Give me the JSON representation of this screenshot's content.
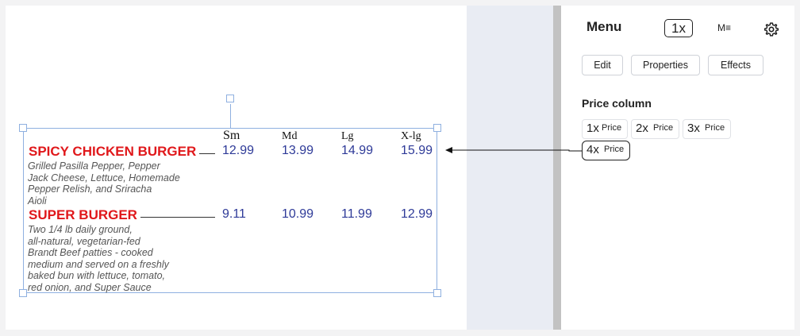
{
  "menu_item": {
    "headers": [
      "Sm",
      "Md",
      "Lg",
      "X-lg"
    ],
    "items": [
      {
        "name": "SPICY CHICKEN BURGER",
        "prices": [
          "12.99",
          "13.99",
          "14.99",
          "15.99"
        ],
        "description": [
          "Grilled Pasilla Pepper, Pepper",
          "Jack Cheese, Lettuce, Homemade",
          "Pepper Relish, and Sriracha",
          "Aioli"
        ]
      },
      {
        "name": "SUPER BURGER",
        "prices": [
          "9.11",
          "10.99",
          "11.99",
          "12.99"
        ],
        "description": [
          "Two 1/4 lb daily ground,",
          "all-natural, vegetarian-fed",
          "Brandt Beef patties - cooked",
          "medium and served on a freshly",
          "baked bun with lettuce, tomato,",
          "red onion, and Super Sauce"
        ]
      }
    ]
  },
  "panel": {
    "title": "Menu",
    "scale_button": "1x",
    "markdown_icon": "M≡",
    "settings_icon": "gear-icon",
    "tabs": [
      "Edit",
      "Properties",
      "Effects"
    ],
    "price_column_label": "Price column",
    "price_options": [
      {
        "big": "1x",
        "small": "Price"
      },
      {
        "big": "2x",
        "small": "Price"
      },
      {
        "big": "3x",
        "small": "Price"
      },
      {
        "big": "4x",
        "small": "Price",
        "selected": true
      }
    ]
  },
  "colors": {
    "item_name": "#e0181b",
    "price": "#2e3a98",
    "selection": "#8fb0e0"
  }
}
